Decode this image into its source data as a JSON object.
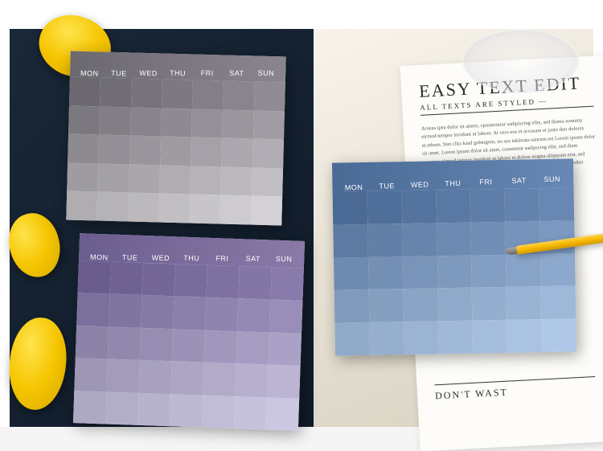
{
  "days": [
    "MON",
    "TUE",
    "WED",
    "THU",
    "FRI",
    "SAT",
    "SUN"
  ],
  "newspaper": {
    "title": "EASY TEXT EDIT",
    "subtitle": "ALL TEXTS ARE STYLED —",
    "body": "Aroeas ipsu dolor sit amets, cpnstectetur sadipiscing elits, sed diama nonumy eirmod tempor invidunt ut labore. At vero eos et accusam et justo duo dolores et.rebum. Stet clita kasd gubergren, no sea takimata sanctus est Lorem ipsum dolor sit amet. Lorem ipsum dolor sit amet, consetetur sadipscing elitr, sed diam nonumy eirmod tempor invidunt ut labore et dolore magna aliquyam erat, sed diam voluptua. At vero eos et accusam et justo duo dolores et ea rebum sther green.",
    "footer": "DON'T WAST"
  },
  "planners": {
    "grey": {
      "colors": [
        [
          "#6b6870",
          "#716d76",
          "#77727c",
          "#7d7882",
          "#837e88",
          "#89848e",
          "#8f8a94"
        ],
        [
          "#7c7880",
          "#827e86",
          "#88848c",
          "#8e8a92",
          "#949098",
          "#9a969e",
          "#a09ca4"
        ],
        [
          "#8d8a90",
          "#938f96",
          "#99959c",
          "#9f9ba2",
          "#a5a1a8",
          "#aba7ae",
          "#b1adb4"
        ],
        [
          "#9e9ca0",
          "#a4a1a6",
          "#aaa7ac",
          "#b0adb2",
          "#b6b3b8",
          "#bcb9be",
          "#c2bfc4"
        ],
        [
          "#afadb0",
          "#b5b3b6",
          "#bbb9bc",
          "#c1bfc2",
          "#c7c5c8",
          "#cdcbce",
          "#d3d1d4"
        ]
      ]
    },
    "purple": {
      "colors": [
        [
          "#6a5d8e",
          "#6f6293",
          "#746798",
          "#796c9d",
          "#7e71a2",
          "#8376a7",
          "#887bac"
        ],
        [
          "#7b709b",
          "#8075a0",
          "#857aa5",
          "#8a7faa",
          "#8f84af",
          "#9489b4",
          "#998eb9"
        ],
        [
          "#8c83a8",
          "#9188ad",
          "#968db2",
          "#9b92b7",
          "#a097bc",
          "#a59cc1",
          "#aaa1c6"
        ],
        [
          "#9d96b5",
          "#a29bba",
          "#a7a0bf",
          "#aca5c4",
          "#b1aac9",
          "#b6afce",
          "#bbb4d3"
        ],
        [
          "#aea9c2",
          "#b3aec7",
          "#b8b3cc",
          "#bdb8d1",
          "#c2bdd6",
          "#c7c2db",
          "#ccc7e0"
        ]
      ]
    },
    "blue": {
      "colors": [
        [
          "#4a6a95",
          "#4f6f9a",
          "#54749f",
          "#5979a4",
          "#5e7ea9",
          "#6383ae",
          "#6888b3"
        ],
        [
          "#5c7aa2",
          "#617fa7",
          "#6684ac",
          "#6b89b1",
          "#708eb6",
          "#7593bb",
          "#7a98c0"
        ],
        [
          "#6e8aaf",
          "#738fb4",
          "#7894b9",
          "#7d99be",
          "#829ec3",
          "#87a3c8",
          "#8ca8cd"
        ],
        [
          "#809abc",
          "#859fc1",
          "#8aa4c6",
          "#8fa9cb",
          "#94aed0",
          "#99b3d5",
          "#9eb8da"
        ],
        [
          "#92aac9",
          "#97afce",
          "#9cb4d3",
          "#a1b9d8",
          "#a6bedd",
          "#abc3e2",
          "#b0c8e7"
        ]
      ]
    }
  }
}
